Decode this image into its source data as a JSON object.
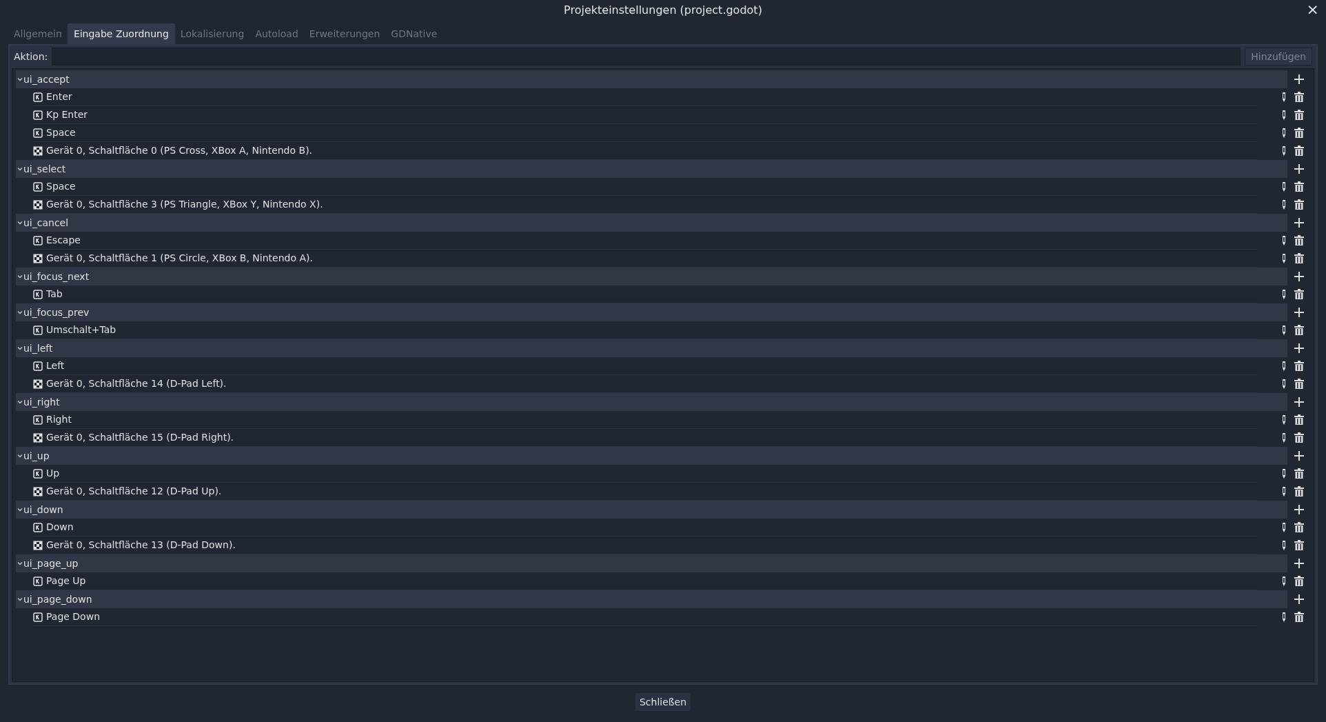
{
  "window": {
    "title": "Projekteinstellungen (project.godot)",
    "close": "×"
  },
  "tabs": [
    {
      "label": "Allgemein",
      "selected": false
    },
    {
      "label": "Eingabe Zuordnung",
      "selected": true
    },
    {
      "label": "Lokalisierung",
      "selected": false
    },
    {
      "label": "Autoload",
      "selected": false
    },
    {
      "label": "Erweiterungen",
      "selected": false
    },
    {
      "label": "GDNative",
      "selected": false
    }
  ],
  "action_bar": {
    "label": "Aktion:",
    "button": "Hinzufügen"
  },
  "actions": [
    {
      "name": "ui_accept",
      "expanded": true,
      "events": [
        {
          "kind": "key",
          "label": "Enter"
        },
        {
          "kind": "key",
          "label": "Kp Enter"
        },
        {
          "kind": "key",
          "label": "Space"
        },
        {
          "kind": "joypad",
          "label": "Gerät 0, Schaltfläche 0 (PS Cross, XBox A, Nintendo B)."
        }
      ]
    },
    {
      "name": "ui_select",
      "expanded": true,
      "events": [
        {
          "kind": "key",
          "label": "Space"
        },
        {
          "kind": "joypad",
          "label": "Gerät 0, Schaltfläche 3 (PS Triangle, XBox Y, Nintendo X)."
        }
      ]
    },
    {
      "name": "ui_cancel",
      "expanded": true,
      "events": [
        {
          "kind": "key",
          "label": "Escape"
        },
        {
          "kind": "joypad",
          "label": "Gerät 0, Schaltfläche 1 (PS Circle, XBox B, Nintendo A)."
        }
      ]
    },
    {
      "name": "ui_focus_next",
      "expanded": true,
      "events": [
        {
          "kind": "key",
          "label": "Tab"
        }
      ]
    },
    {
      "name": "ui_focus_prev",
      "expanded": true,
      "events": [
        {
          "kind": "key",
          "label": "Umschalt+Tab"
        }
      ]
    },
    {
      "name": "ui_left",
      "expanded": true,
      "events": [
        {
          "kind": "key",
          "label": "Left"
        },
        {
          "kind": "joypad",
          "label": "Gerät 0, Schaltfläche 14 (D-Pad Left)."
        }
      ]
    },
    {
      "name": "ui_right",
      "expanded": true,
      "events": [
        {
          "kind": "key",
          "label": "Right"
        },
        {
          "kind": "joypad",
          "label": "Gerät 0, Schaltfläche 15 (D-Pad Right)."
        }
      ]
    },
    {
      "name": "ui_up",
      "expanded": true,
      "events": [
        {
          "kind": "key",
          "label": "Up"
        },
        {
          "kind": "joypad",
          "label": "Gerät 0, Schaltfläche 12 (D-Pad Up)."
        }
      ]
    },
    {
      "name": "ui_down",
      "expanded": true,
      "events": [
        {
          "kind": "key",
          "label": "Down"
        },
        {
          "kind": "joypad",
          "label": "Gerät 0, Schaltfläche 13 (D-Pad Down)."
        }
      ]
    },
    {
      "name": "ui_page_up",
      "expanded": true,
      "events": [
        {
          "kind": "key",
          "label": "Page Up"
        }
      ]
    },
    {
      "name": "ui_page_down",
      "expanded": true,
      "events": [
        {
          "kind": "key",
          "label": "Page Down"
        }
      ]
    }
  ],
  "footer": {
    "button": "Schließen"
  }
}
